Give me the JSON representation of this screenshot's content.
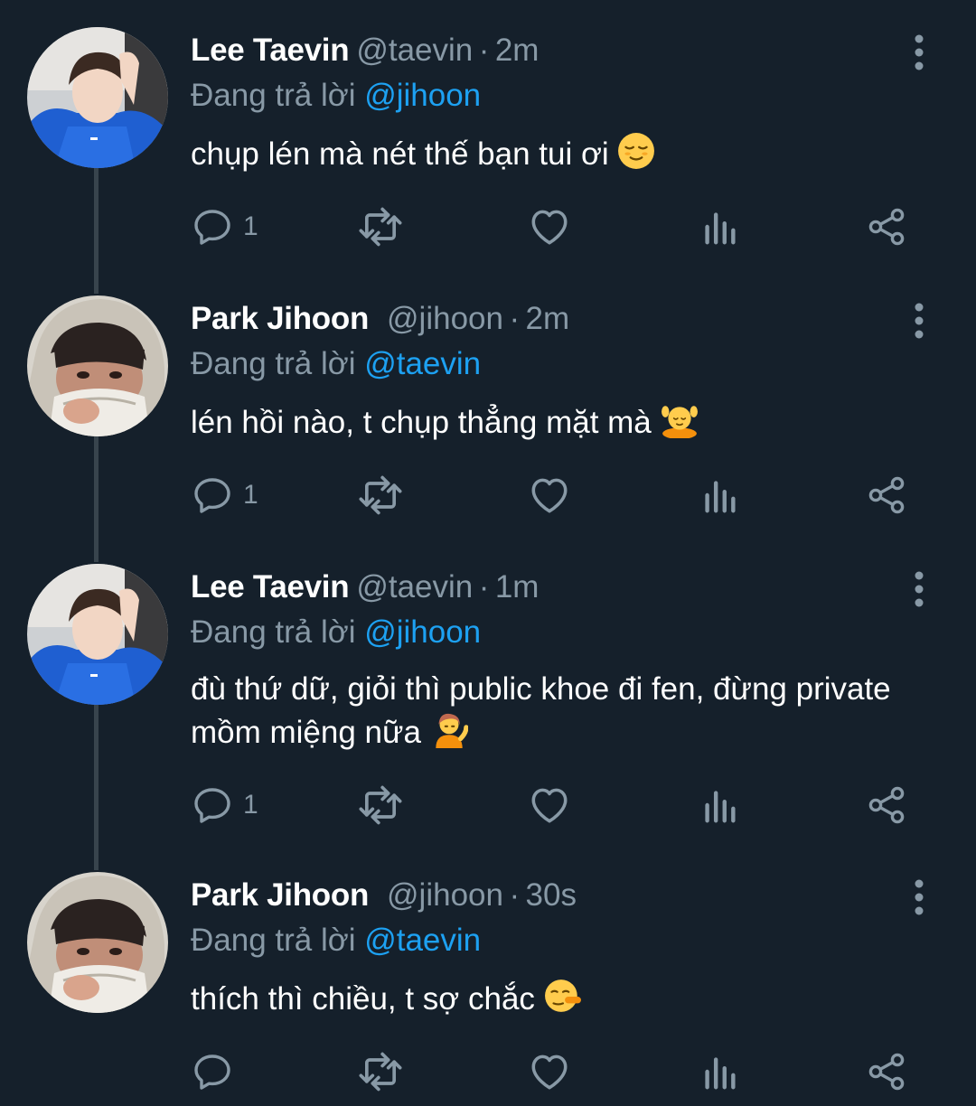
{
  "colors": {
    "background": "#15202b",
    "text_primary": "#ffffff",
    "text_secondary": "#8899a6",
    "link": "#1da1f2",
    "thread_line": "#38444d"
  },
  "icons": {
    "reply": "reply-icon",
    "retweet": "retweet-icon",
    "like": "heart-icon",
    "analytics": "analytics-icon",
    "share": "share-icon",
    "more": "more-vertical-icon"
  },
  "tweets": [
    {
      "name": "Lee Taevin",
      "handle": "@taevin",
      "sep": "·",
      "time": "2m",
      "reply_prefix": "Đang trả lời",
      "reply_to": "@jihoon",
      "text": "chụp lén mà nét thế bạn tui ơi",
      "emoji": "relieved-face-emoji",
      "reply_count": "1"
    },
    {
      "name": "Park Jihoon",
      "handle": "@jihoon",
      "sep": "·",
      "time": "2m",
      "reply_prefix": "Đang trả lời",
      "reply_to": "@taevin",
      "text": "lén hồi nào, t chụp thẳng mặt mà",
      "emoji": "person-getting-massage-emoji",
      "reply_count": "1"
    },
    {
      "name": "Lee Taevin",
      "handle": "@taevin",
      "sep": "·",
      "time": "1m",
      "reply_prefix": "Đang trả lời",
      "reply_to": "@jihoon",
      "text": "đù thứ dữ, giỏi thì public khoe đi fen, đừng private mồm miệng nữa",
      "emoji": "person-tipping-hand-emoji",
      "reply_count": "1"
    },
    {
      "name": "Park Jihoon",
      "handle": "@jihoon",
      "sep": "·",
      "time": "30s",
      "reply_prefix": "Đang trả lời",
      "reply_to": "@taevin",
      "text": "thích thì chiều, t sợ chắc",
      "emoji": "lying-face-emoji",
      "reply_count": ""
    }
  ]
}
